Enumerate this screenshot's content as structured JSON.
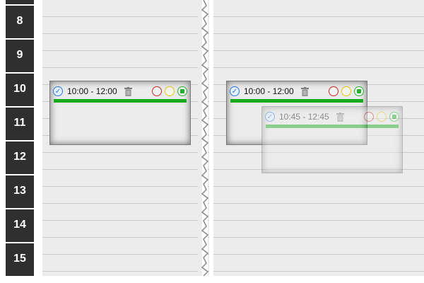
{
  "hours": [
    "8",
    "9",
    "10",
    "11",
    "12",
    "13",
    "14",
    "15"
  ],
  "colors": {
    "status_bar": "#17ab1b",
    "red": "#cc2121",
    "yellow": "#e2c400",
    "green": "#20b02a",
    "check": "#2b74d8"
  },
  "events": {
    "left": {
      "time": "10:00 - 12:00"
    },
    "right": {
      "time": "10:00 - 12:00"
    },
    "ghost": {
      "time": "10:45 - 12:45"
    }
  }
}
